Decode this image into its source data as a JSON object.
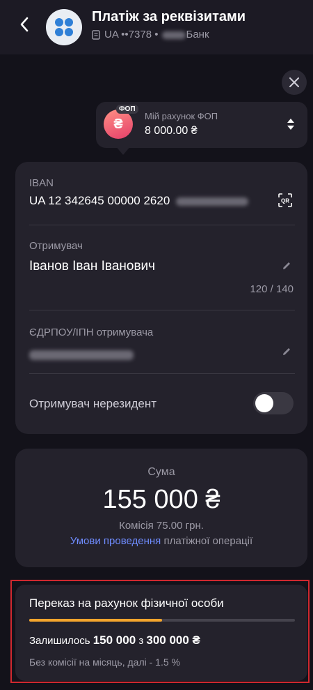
{
  "header": {
    "back_icon": "chevron-left-icon",
    "title": "Платіж за реквізитами",
    "account_masked": "UA ••7378 •",
    "bank_suffix": "Банк"
  },
  "account": {
    "badge": "ФОП",
    "avatar_symbol": "₴",
    "name": "Мій рахунок ФОП",
    "balance": "8 000.00 ₴"
  },
  "form": {
    "iban_label": "IBAN",
    "iban_value": "UA 12 342645 00000 2620",
    "recipient_label": "Отримувач",
    "recipient_value": "Іванов Іван Іванович",
    "recipient_counter": "120 / 140",
    "edrpou_label": "ЄДРПОУ/ІПН отримувача",
    "nonresident_label": "Отримувач нерезидент",
    "nonresident_enabled": false
  },
  "sum": {
    "label": "Сума",
    "amount": "155 000 ₴",
    "fee": "Комісія 75.00 грн.",
    "terms_link": "Умови проведення",
    "terms_rest": " платіжної операції"
  },
  "limit": {
    "title": "Переказ на рахунок фізичної особи",
    "remaining_prefix": "Залишилось ",
    "remaining_value": "150 000",
    "remaining_mid": " з ",
    "total_value": "300 000 ₴",
    "note": "Без комісії на місяць, далі - 1.5 %",
    "progress_fraction": 0.5
  },
  "colors": {
    "background": "#13121a",
    "card": "#24222c",
    "accent_link": "#6f8cff",
    "progress": "#f4a52d",
    "highlight_border": "#d0282f"
  }
}
